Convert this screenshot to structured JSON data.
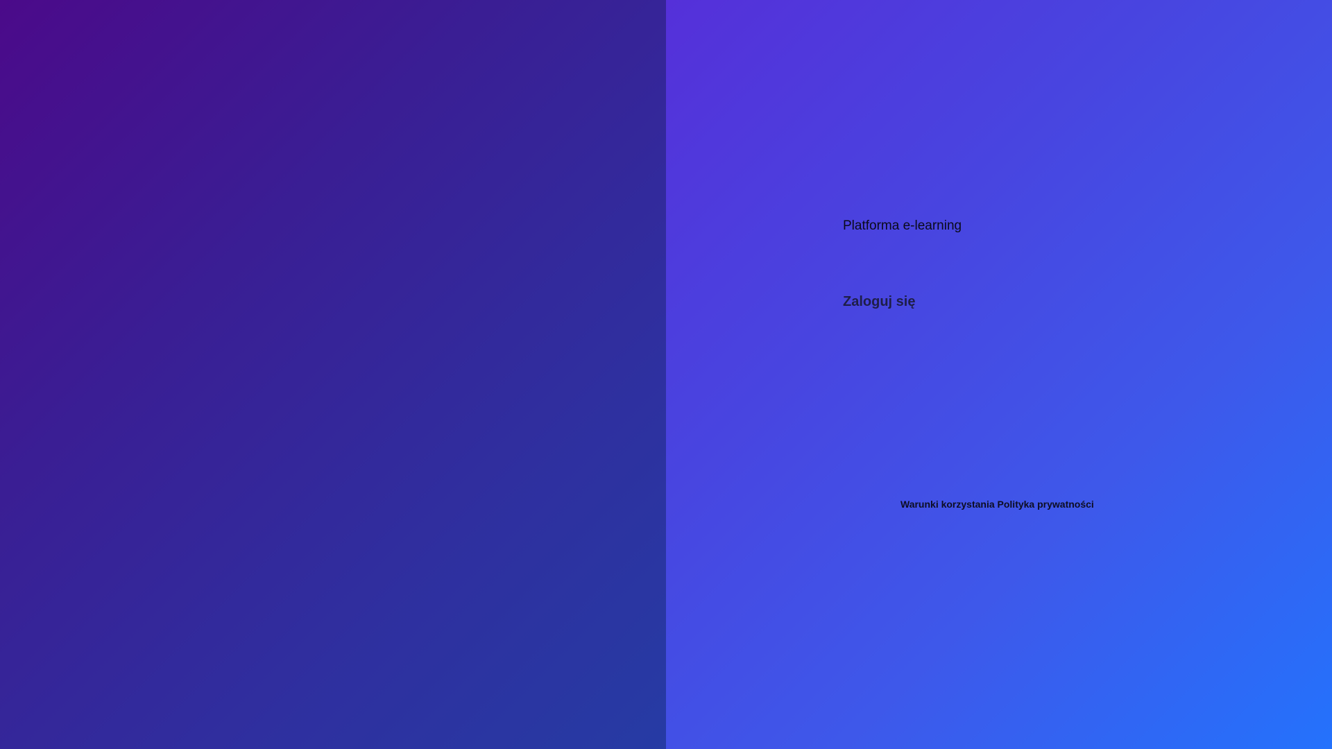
{
  "brand": {
    "platform_title": "Platforma e-learning"
  },
  "login": {
    "heading": "Zaloguj się"
  },
  "footer": {
    "terms_link": "Warunki korzystania",
    "privacy_link": "Polityka prywatności"
  },
  "colors": {
    "left_gradient_start": "#4b0a8a",
    "left_gradient_end": "#263ba4",
    "right_gradient_start": "#5530d9",
    "right_gradient_end": "#2472fc"
  }
}
